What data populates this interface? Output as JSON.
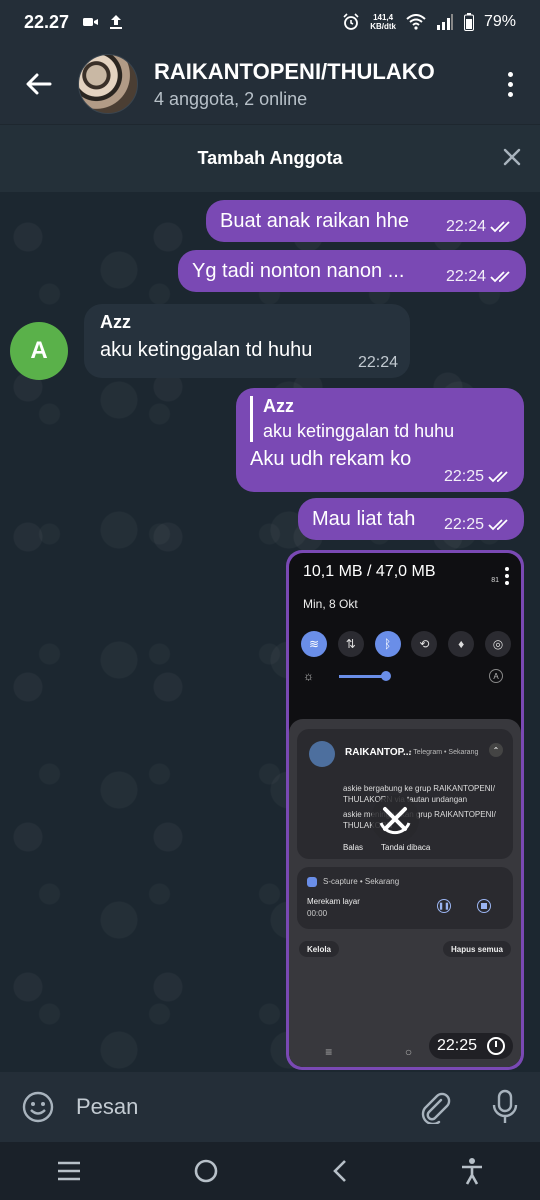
{
  "status_bar": {
    "time": "22.27",
    "net_speed_value": "141,4",
    "net_speed_unit": "KB/dtk",
    "battery": "79%"
  },
  "header": {
    "title": "RAIKANTOPENI/THULAKO",
    "subtitle": "4 anggota, 2 online"
  },
  "add_member_bar": {
    "label": "Tambah Anggota"
  },
  "messages": [
    {
      "text": "Buat anak raikan hhe",
      "time": "22:24"
    },
    {
      "text": "Yg tadi nonton nanon ...",
      "time": "22:24"
    },
    {
      "sender": "Azz",
      "avatar_letter": "A",
      "text": "aku ketinggalan td huhu",
      "time": "22:24"
    },
    {
      "quote_name": "Azz",
      "quote_text": "aku ketinggalan td huhu",
      "text": "Aku udh rekam ko",
      "time": "22:25"
    },
    {
      "text": "Mau liat tah",
      "time": "22:25"
    }
  ],
  "media": {
    "size": "10,1 MB / 47,0 MB",
    "inner_status": "81",
    "date": "Min, 8 Okt",
    "notif1": {
      "title": "RAIKANTOP...",
      "source": "• Telegram • Sekarang",
      "body1": "askie bergabung ke grup RAIKANTOPENI/ THULAKORN via tautan undangan",
      "body2": "askie meninggalkan grup RAIKANTOPENI/ THULAKORN",
      "action_reply": "Balas",
      "action_read": "Tandai dibaca"
    },
    "notif2": {
      "source": "S-capture • Sekarang",
      "title": "Merekam layar",
      "time": "00:00"
    },
    "manage": "Kelola",
    "clear_all": "Hapus semua",
    "time": "22:25"
  },
  "input": {
    "placeholder": "Pesan"
  },
  "colors": {
    "outgoing_bubble": "#7a49b4",
    "incoming_bubble": "#26323d",
    "header_bg": "#242e38",
    "avatar_a": "#5ab14a"
  }
}
